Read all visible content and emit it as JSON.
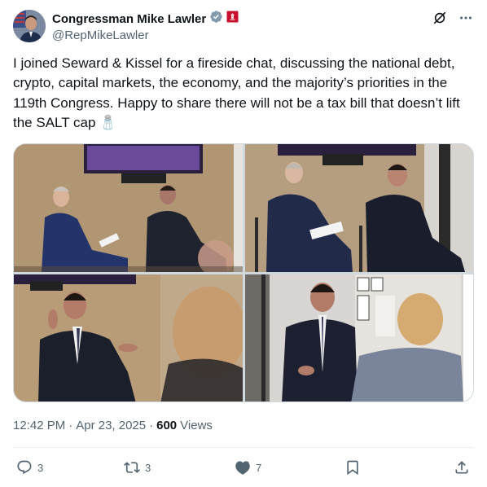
{
  "post": {
    "display_name": "Congressman Mike Lawler",
    "handle": "@RepMikeLawler",
    "text": "I joined Seward & Kissel for a fireside chat, discussing the national debt, crypto, capital markets, the economy, and the majority’s priorities in the 119th Congress. Happy to share there will not be a tax bill that doesn’t lift the SALT cap 🧂",
    "time": "12:42 PM",
    "separator": "·",
    "date": "Apr 23, 2025",
    "views_count": "600",
    "views_label": "Views"
  },
  "stats": {
    "replies": "3",
    "reposts": "3",
    "likes": "7"
  },
  "icons": {
    "verified": "verified-badge-icon",
    "affiliation": "government-affiliation-icon",
    "grok": "grok-icon",
    "more": "more-options-icon",
    "reply": "reply-icon",
    "repost": "repost-icon",
    "like": "like-icon",
    "bookmark": "bookmark-icon",
    "share": "share-icon"
  },
  "colors": {
    "text_primary": "#0f1419",
    "text_secondary": "#536471",
    "verified": "#829aab",
    "affiliation_badge": "#c8102e",
    "divider": "#eff3f4"
  }
}
